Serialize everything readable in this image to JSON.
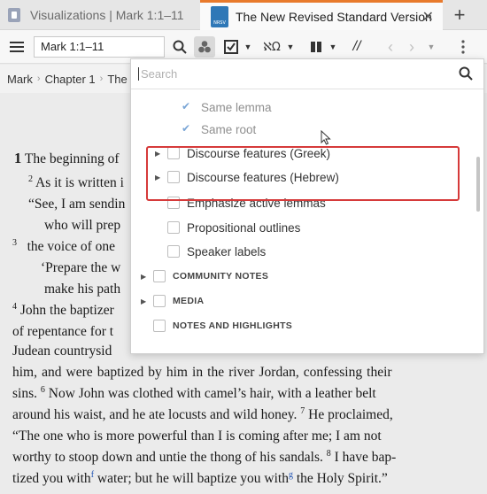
{
  "tabs": [
    {
      "label": "Visualizations | Mark 1:1–11",
      "active": false
    },
    {
      "label": "The New Revised Standard Version",
      "active": true,
      "badge": "NRSV"
    }
  ],
  "toolbar": {
    "reference": "Mark 1:1–11",
    "icons": [
      "menu-icon",
      "search-icon",
      "visual-filters-icon",
      "checklist-icon",
      "interlinear-icon",
      "columns-icon",
      "parallel-icon",
      "back-icon",
      "forward-icon",
      "more-icon"
    ]
  },
  "breadcrumb": {
    "book": "Mark",
    "chapter": "Chapter 1",
    "partial": "The I"
  },
  "document": {
    "lines": [
      {
        "html": "<span class=\"cn\">1</span> The beginning of"
      },
      {
        "html": "<span class=\"vn\">2</span> As it is written i"
      },
      {
        "html": "“See, I am sendin"
      },
      {
        "html": "who will prep"
      },
      {
        "html": "<span class=\"vn\">3</span>&nbsp;&nbsp;&nbsp;the voice of one"
      },
      {
        "html": "‘Prepare the w"
      },
      {
        "html": "make his path"
      },
      {
        "html": "<span class=\"vn\">4</span> John the baptizer"
      },
      {
        "html": "of repentance for t"
      },
      {
        "html": "Judean countrysid"
      },
      {
        "html": "him, and were baptized by him in the river Jordan, confessing their"
      },
      {
        "html": "sins. <span class=\"vn\">6</span> Now John was clothed with camel’s hair, with a leather belt"
      },
      {
        "html": "around his waist, and he ate locusts and wild honey. <span class=\"vn\">7</span> He proclaimed,"
      },
      {
        "html": "“The one who is more powerful than I is coming after me; I am not"
      },
      {
        "html": "worthy to stoop down and untie the thong of his sandals. <span class=\"vn\">8</span> I have bap-"
      },
      {
        "html": "tized you with<span class=\"fn\">f</span> water; but he will baptize you with<span class=\"fn\">g</span> the Holy Spirit.”"
      }
    ]
  },
  "dropdown": {
    "search_placeholder": "Search",
    "options": [
      {
        "label": "Same lemma",
        "state": "checked",
        "indent": 2
      },
      {
        "label": "Same root",
        "state": "checked",
        "indent": 2
      },
      {
        "label": "Discourse features (Greek)",
        "state": "unchecked",
        "indent": 1,
        "expandable": true
      },
      {
        "label": "Discourse features (Hebrew)",
        "state": "unchecked",
        "indent": 1,
        "expandable": true
      },
      {
        "label": "Emphasize active lemmas",
        "state": "unchecked",
        "indent": 1
      },
      {
        "label": "Propositional outlines",
        "state": "unchecked",
        "indent": 1
      },
      {
        "label": "Speaker labels",
        "state": "unchecked",
        "indent": 1
      },
      {
        "label": "COMMUNITY NOTES",
        "state": "unchecked",
        "indent": 0,
        "expandable": true,
        "section": true
      },
      {
        "label": "MEDIA",
        "state": "unchecked",
        "indent": 0,
        "expandable": true,
        "section": true
      },
      {
        "label": "NOTES AND HIGHLIGHTS",
        "state": "unchecked",
        "indent": 0,
        "section": true
      }
    ]
  },
  "colors": {
    "accent": "#e87a2c",
    "highlight": "#d63a3a",
    "link": "#2456b5"
  }
}
